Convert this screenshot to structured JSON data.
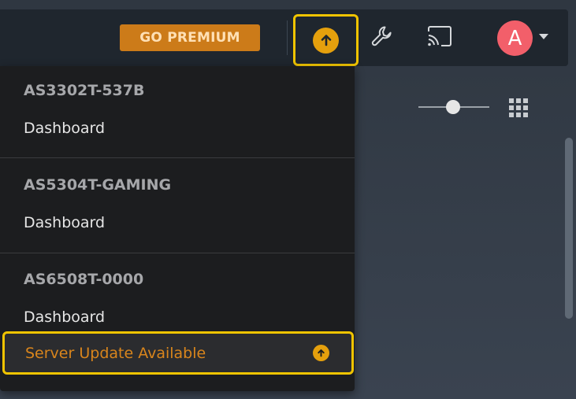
{
  "toolbar": {
    "premium_label": "GO PREMIUM",
    "avatar_letter": "A",
    "icons": [
      "update-available-icon",
      "wrench-icon",
      "cast-icon",
      "chevron-down-icon"
    ],
    "colors": {
      "premium_bg": "#cc7b19",
      "update_accent": "#e5a00d",
      "avatar_bg": "#f25f6a",
      "highlight": "#f0c400"
    }
  },
  "view_controls": {
    "icons": [
      "size-slider",
      "grid-view-icon"
    ]
  },
  "menu": {
    "servers": [
      {
        "name": "AS3302T-537B",
        "link": "Dashboard"
      },
      {
        "name": "AS5304T-GAMING",
        "link": "Dashboard"
      },
      {
        "name": "AS6508T-0000",
        "link": "Dashboard"
      }
    ],
    "update_label": "Server Update Available"
  }
}
